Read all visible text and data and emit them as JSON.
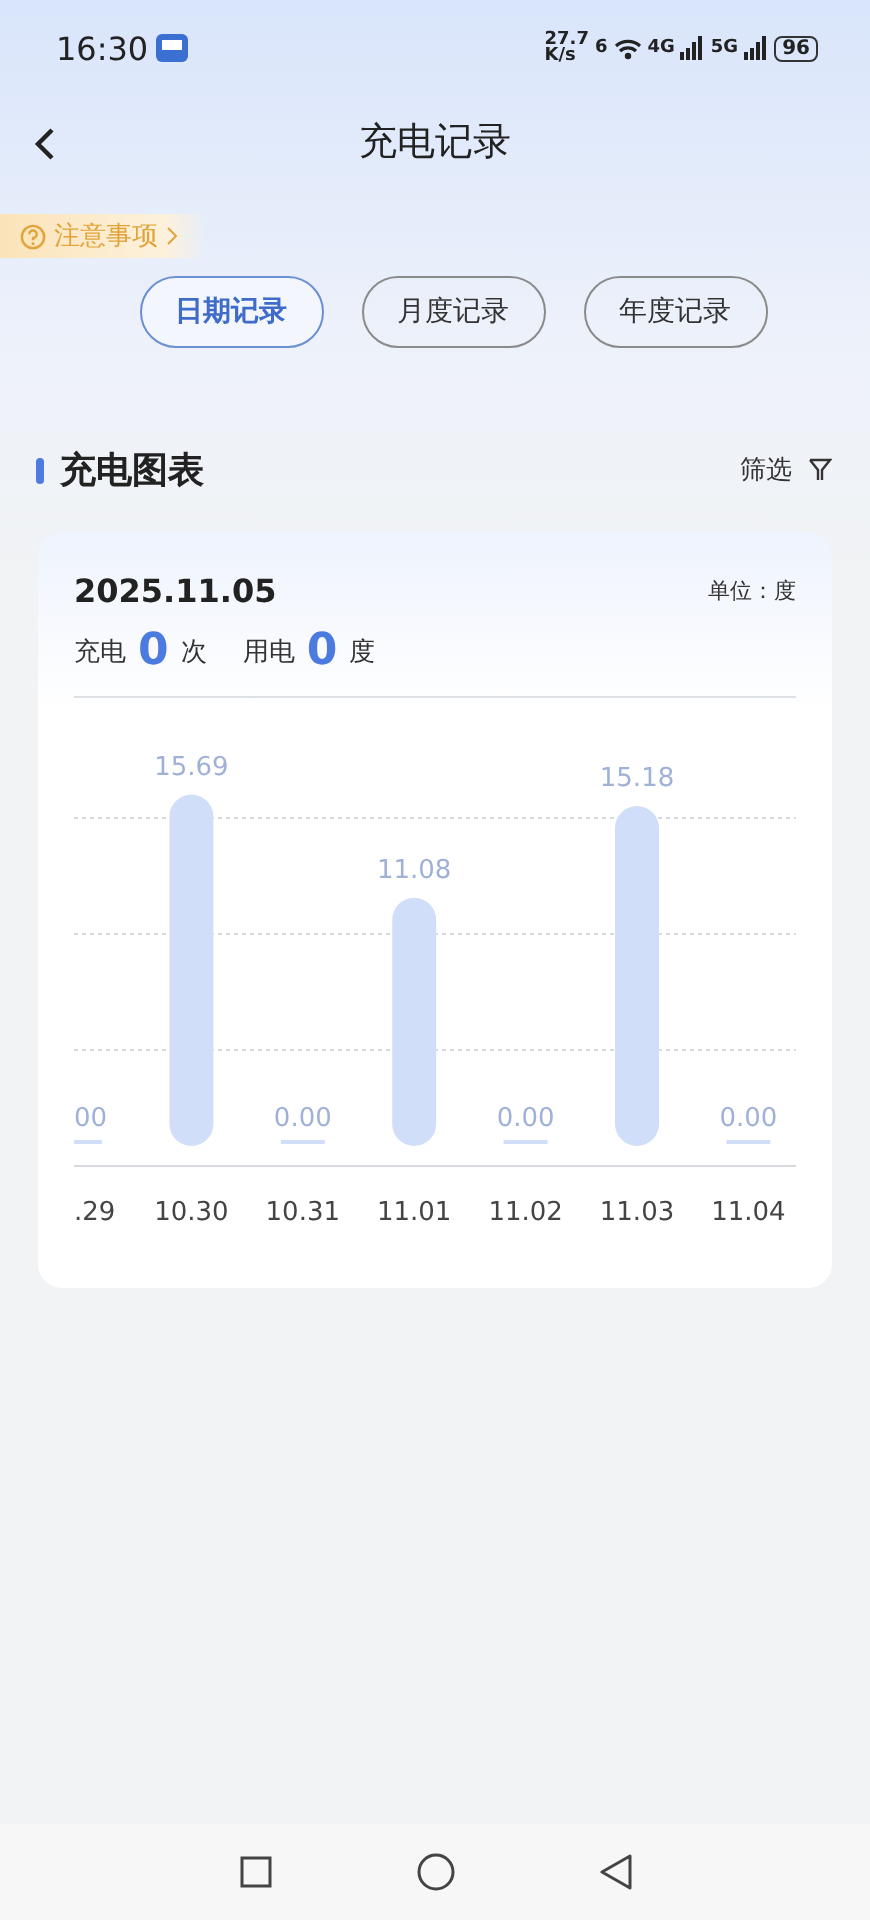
{
  "status_bar": {
    "time": "16:30",
    "speed": "27.7",
    "speed_unit": "K/s",
    "wifi_badge": "6",
    "net1": "4G",
    "net2": "5G",
    "battery": "96"
  },
  "header": {
    "title": "充电记录"
  },
  "notice": {
    "label": "注意事项"
  },
  "tabs": [
    {
      "label": "日期记录",
      "selected": true
    },
    {
      "label": "月度记录",
      "selected": false
    },
    {
      "label": "年度记录",
      "selected": false
    }
  ],
  "section": {
    "title": "充电图表",
    "filter": "筛选"
  },
  "card": {
    "date": "2025.11.05",
    "unit": "单位：度",
    "stats": [
      {
        "label": "充电",
        "value": "0",
        "unit": "次"
      },
      {
        "label": "用电",
        "value": "0",
        "unit": "度"
      }
    ],
    "chart_data": {
      "type": "bar",
      "categories": [
        ".29",
        "10.30",
        "10.31",
        "11.01",
        "11.02",
        "11.03",
        "11.04"
      ],
      "values": [
        0,
        15.69,
        0,
        11.08,
        0,
        15.18,
        0
      ],
      "value_labels": [
        "00",
        "15.69",
        "0.00",
        "11.08",
        "0.00",
        "15.18",
        "0.00"
      ]
    }
  }
}
